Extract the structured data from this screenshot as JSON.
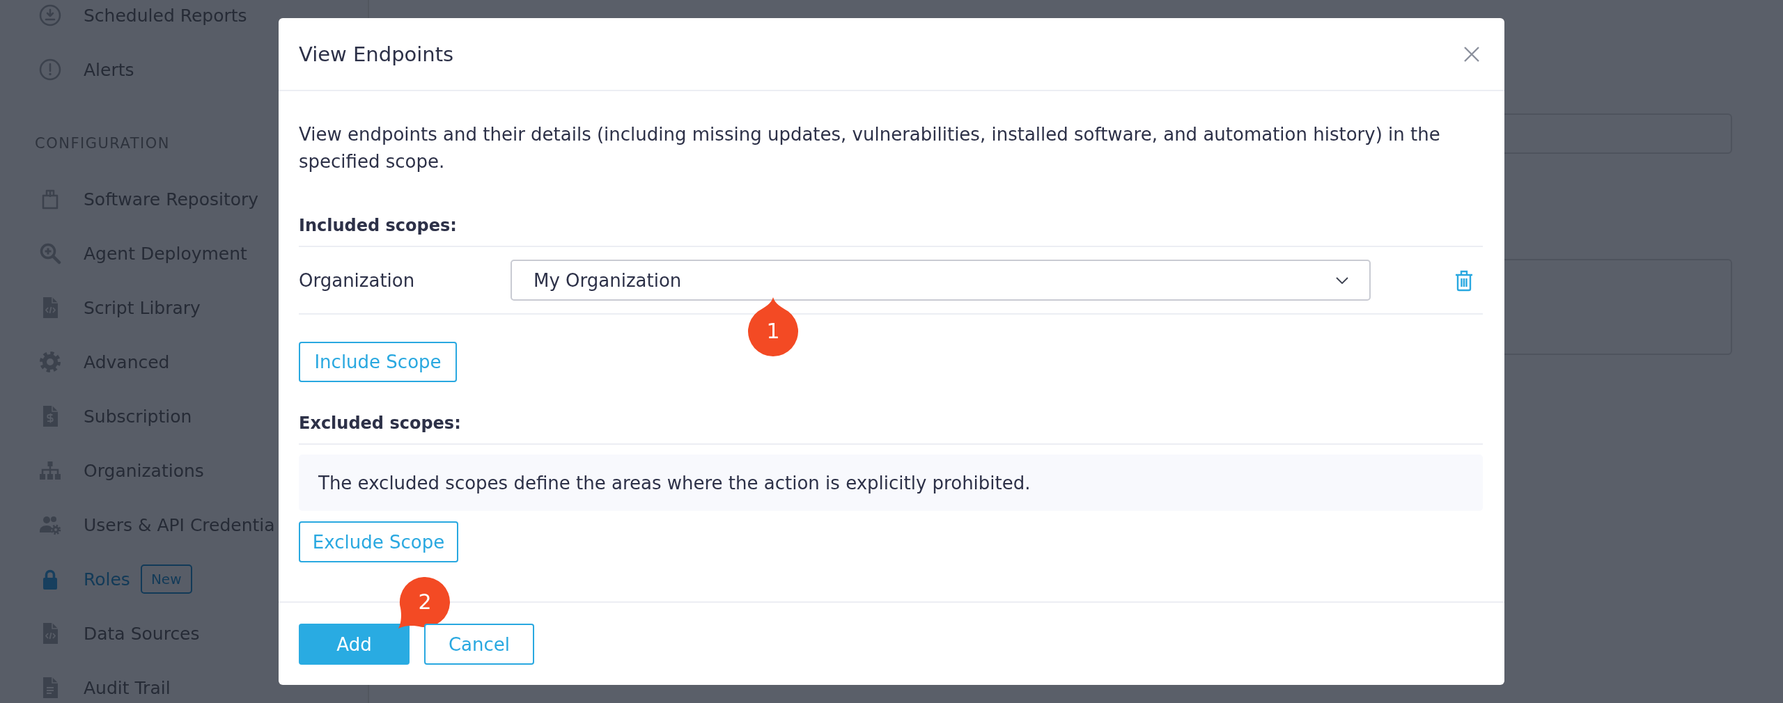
{
  "sidebar": {
    "sections": [
      {
        "items": [
          {
            "label": "Scheduled Reports",
            "selected": false
          },
          {
            "label": "Alerts",
            "selected": false
          }
        ]
      },
      {
        "heading": "CONFIGURATION",
        "items": [
          {
            "label": "Software Repository",
            "selected": false
          },
          {
            "label": "Agent Deployment",
            "selected": false
          },
          {
            "label": "Script Library",
            "selected": false
          },
          {
            "label": "Advanced",
            "selected": false
          },
          {
            "label": "Subscription",
            "selected": false
          },
          {
            "label": "Organizations",
            "selected": false
          },
          {
            "label": "Users & API Credentia",
            "selected": false
          },
          {
            "label": "Roles",
            "selected": true,
            "badge": "New"
          },
          {
            "label": "Data Sources",
            "selected": false
          },
          {
            "label": "Audit Trail",
            "selected": false
          }
        ]
      }
    ]
  },
  "dialog": {
    "title": "View Endpoints",
    "description": "View endpoints and their details (including missing updates, vulnerabilities, installed software, and automation history) in the specified scope.",
    "included": {
      "heading": "Included scopes:",
      "rows": [
        {
          "label": "Organization",
          "value": "My Organization",
          "marker": "1"
        }
      ],
      "button": "Include Scope"
    },
    "excluded": {
      "heading": "Excluded scopes:",
      "note": "The excluded scopes define the areas where the action is explicitly prohibited.",
      "button": "Exclude Scope"
    },
    "buttons": [
      {
        "label": "Add",
        "kind": "primary",
        "marker": "2"
      },
      {
        "label": "Cancel",
        "kind": "secondary"
      }
    ]
  }
}
